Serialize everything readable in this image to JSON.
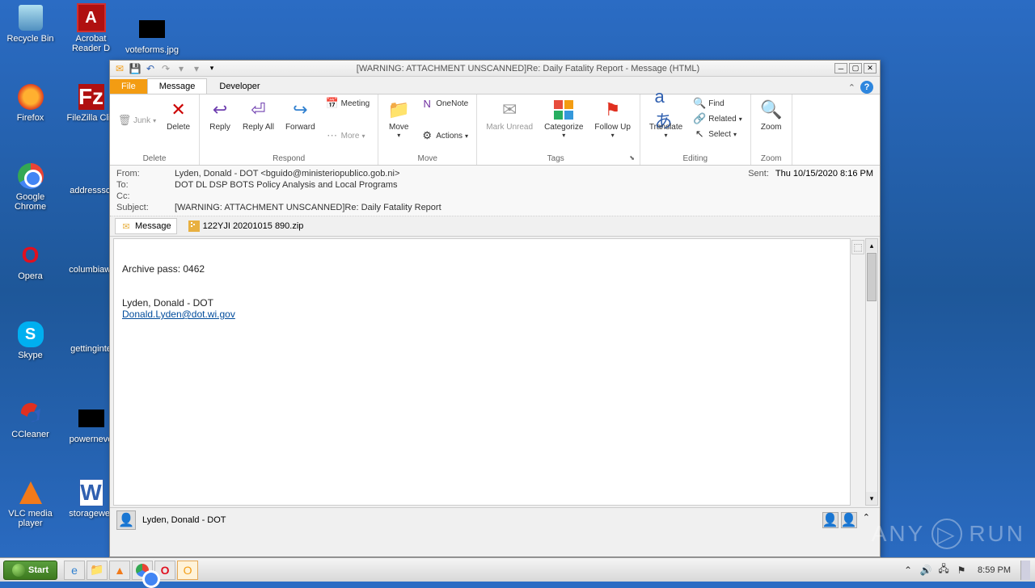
{
  "desktop": {
    "icons": [
      {
        "label": "Recycle Bin"
      },
      {
        "label": "Acrobat Reader D"
      },
      {
        "label": "voteforms.jpg"
      },
      {
        "label": "Firefox"
      },
      {
        "label": "FileZilla Clie"
      },
      {
        "label": "Google Chrome"
      },
      {
        "label": "addresssci"
      },
      {
        "label": "Opera"
      },
      {
        "label": "columbiawi"
      },
      {
        "label": "Skype"
      },
      {
        "label": "gettinginte"
      },
      {
        "label": "CCleaner"
      },
      {
        "label": "powerneve"
      },
      {
        "label": "VLC media player"
      },
      {
        "label": "storagewer"
      }
    ]
  },
  "window": {
    "title": "[WARNING: ATTACHMENT UNSCANNED]Re: Daily Fatality Report  -  Message (HTML)",
    "tabs": {
      "file": "File",
      "message": "Message",
      "developer": "Developer"
    },
    "ribbon": {
      "delete": {
        "junk": "Junk",
        "delete": "Delete",
        "group": "Delete"
      },
      "respond": {
        "reply": "Reply",
        "reply_all": "Reply All",
        "forward": "Forward",
        "meeting": "Meeting",
        "more": "More",
        "group": "Respond"
      },
      "move": {
        "move": "Move",
        "onenote": "OneNote",
        "actions": "Actions",
        "group": "Move"
      },
      "tags": {
        "mark_unread": "Mark Unread",
        "categorize": "Categorize",
        "follow_up": "Follow Up",
        "group": "Tags"
      },
      "editing": {
        "translate": "Translate",
        "find": "Find",
        "related": "Related",
        "select": "Select",
        "group": "Editing"
      },
      "zoom": {
        "zoom": "Zoom",
        "group": "Zoom"
      }
    },
    "headers": {
      "from_label": "From:",
      "from_value": "Lyden, Donald - DOT <bguido@ministeriopublico.gob.ni>",
      "to_label": "To:",
      "to_value": "DOT DL DSP BOTS Policy Analysis and Local Programs",
      "cc_label": "Cc:",
      "cc_value": "",
      "subject_label": "Subject:",
      "subject_value": "[WARNING: ATTACHMENT UNSCANNED]Re: Daily Fatality Report",
      "sent_label": "Sent:",
      "sent_value": "Thu 10/15/2020 8:16 PM"
    },
    "attachments": {
      "message_tab": "Message",
      "file_name": "122YJI 20201015 890.zip"
    },
    "body": {
      "line1": "Archive pass: 0462",
      "line3": "Lyden, Donald - DOT",
      "email": "Donald.Lyden@dot.wi.gov"
    },
    "people_pane": {
      "name": "Lyden, Donald - DOT"
    }
  },
  "taskbar": {
    "start": "Start",
    "clock": "8:59 PM"
  },
  "watermark": {
    "text1": "ANY",
    "text2": "RUN"
  }
}
